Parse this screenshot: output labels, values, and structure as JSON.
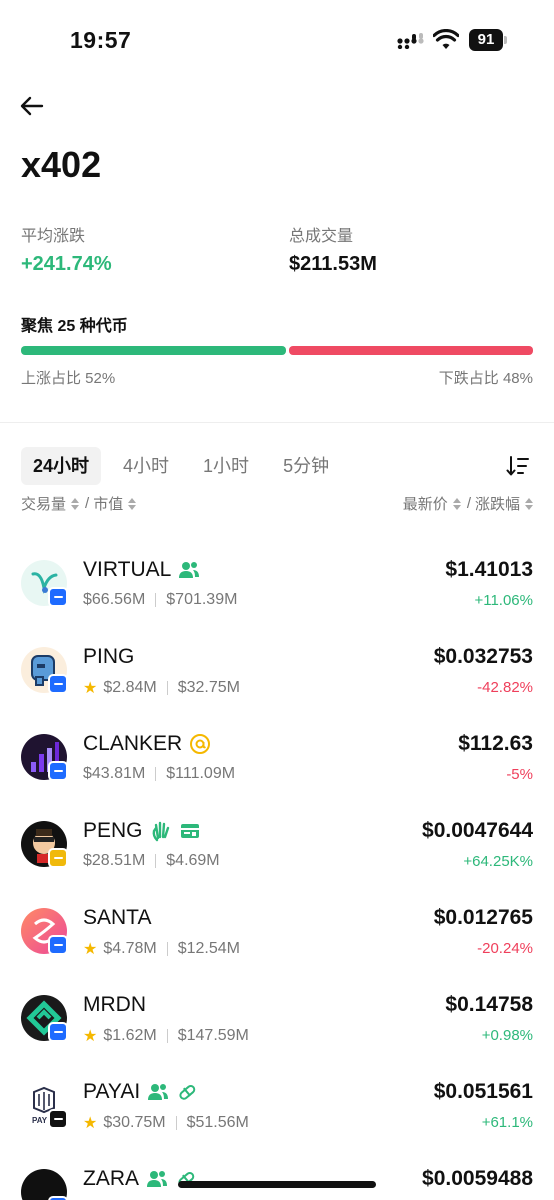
{
  "status_bar": {
    "time": "19:57",
    "battery": "91"
  },
  "header": {
    "title": "x402"
  },
  "stats": {
    "avg_change_label": "平均涨跌",
    "avg_change_value": "+241.74%",
    "volume_label": "总成交量",
    "volume_value": "$211.53M"
  },
  "focus": {
    "title": "聚焦 25 种代币",
    "up_label": "上涨占比 52%",
    "down_label": "下跌占比 48%",
    "up_fraction": 0.52,
    "down_fraction": 0.48
  },
  "tabs": [
    "24小时",
    "4小时",
    "1小时",
    "5分钟"
  ],
  "sort": {
    "volume": "交易量",
    "sep1": "/",
    "mcap": "市值",
    "price": "最新价",
    "sep2": "/",
    "change": "涨跌幅"
  },
  "tokens": [
    {
      "name": "VIRTUAL",
      "starred": false,
      "volume": "$66.56M",
      "mcap": "$701.39M",
      "price": "$1.41013",
      "change": "+11.06%",
      "direction": "up",
      "chain": "base",
      "tags": [
        "community-icon"
      ]
    },
    {
      "name": "PING",
      "starred": true,
      "volume": "$2.84M",
      "mcap": "$32.75M",
      "price": "$0.032753",
      "change": "-42.82%",
      "direction": "down",
      "chain": "base",
      "tags": []
    },
    {
      "name": "CLANKER",
      "starred": false,
      "volume": "$43.81M",
      "mcap": "$111.09M",
      "price": "$112.63",
      "change": "-5%",
      "direction": "down",
      "chain": "base",
      "tags": [
        "at-sign-icon"
      ]
    },
    {
      "name": "PENG",
      "starred": false,
      "volume": "$28.51M",
      "mcap": "$4.69M",
      "price": "$0.0047644",
      "change": "+64.25K%",
      "direction": "up",
      "chain": "bnb",
      "tags": [
        "wave-hand-icon",
        "card-icon"
      ]
    },
    {
      "name": "SANTA",
      "starred": true,
      "volume": "$4.78M",
      "mcap": "$12.54M",
      "price": "$0.012765",
      "change": "-20.24%",
      "direction": "down",
      "chain": "base",
      "tags": []
    },
    {
      "name": "MRDN",
      "starred": true,
      "volume": "$1.62M",
      "mcap": "$147.59M",
      "price": "$0.14758",
      "change": "+0.98%",
      "direction": "up",
      "chain": "base",
      "tags": []
    },
    {
      "name": "PAYAI",
      "starred": true,
      "volume": "$30.75M",
      "mcap": "$51.56M",
      "price": "$0.051561",
      "change": "+61.1%",
      "direction": "up",
      "chain": "sol",
      "tags": [
        "community-icon",
        "pill-icon"
      ]
    },
    {
      "name": "ZARA",
      "starred": false,
      "volume": "",
      "mcap": "",
      "price": "$0.0059488",
      "change": "",
      "direction": "up",
      "chain": "base",
      "tags": [
        "community-icon",
        "pill-icon"
      ]
    }
  ],
  "colors": {
    "up": "#2db87a",
    "down": "#ef3f5b",
    "muted": "#777777"
  }
}
